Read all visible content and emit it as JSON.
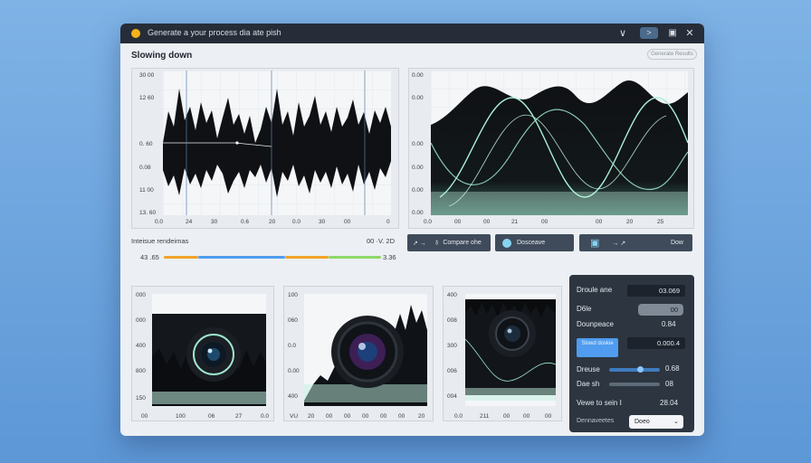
{
  "window": {
    "title": "Generate a your process dia ate pish",
    "minimize_glyph": "∨",
    "go_glyph": ">",
    "save_glyph": "▣",
    "close_glyph": "✕"
  },
  "heading": "Slowing down",
  "top_pill": "Generate Results",
  "colors": {
    "accent": "#4f9cf0",
    "titlebar": "#262d38",
    "side_panel": "#2d3540",
    "wave_fill": "#0f1114",
    "glow": "#9fe8cf",
    "meter_orange": "#f2a42a",
    "meter_blue": "#4f9cf0",
    "meter_green": "#8ed86a"
  },
  "chart1": {
    "y_ticks": [
      "30 00",
      "12 60",
      "0. 60",
      "0.08",
      "11 00",
      "13. 60"
    ],
    "x_ticks": [
      "0.0",
      "24",
      "30",
      "0.6",
      "20",
      "0.0",
      "30",
      "00",
      "0"
    ]
  },
  "chart2": {
    "y_ticks": [
      "0.00",
      "0.00",
      "0.00",
      "0.00",
      "0.00",
      "0.00"
    ],
    "x_ticks": [
      "0.0",
      "00",
      "00",
      "21",
      "00",
      "00",
      "20",
      "25"
    ]
  },
  "meter": {
    "title": "Inteisue rendeimas",
    "right_value": "00 ·V. 2D",
    "left_value": "43 .65",
    "end_value": "3.36"
  },
  "toolbar": {
    "share_label": "↗ →",
    "node_icon": "♁",
    "compare_label": "Compare ohe",
    "record_label": "Dosceave",
    "camera_icon": "▣",
    "arrows_label": "→ ↗",
    "dow_label": "Dow"
  },
  "chart3": {
    "y_ticks": [
      "000",
      "000",
      "400",
      "800",
      "150"
    ],
    "x_ticks": [
      "00",
      "100",
      "06",
      "27",
      "0.0"
    ]
  },
  "chart4": {
    "y_ticks": [
      "100",
      "060",
      "0.0",
      "0.00",
      "400"
    ],
    "x_ticks": [
      "VU",
      "20",
      "00",
      "00",
      "00",
      "00",
      "00",
      "20"
    ]
  },
  "chart5": {
    "y_ticks": [
      "400",
      "008",
      "300",
      "006",
      "004"
    ],
    "x_ticks": [
      "0.0",
      "211",
      "00",
      "00",
      "00"
    ]
  },
  "side_panel": {
    "row1_label": "Droule ane",
    "row1_value": "03.069",
    "row2_label": "D6le",
    "row2_value": "00",
    "row3_label": "Dounpeace",
    "row3_value": "0.84",
    "button_label": "Slowd doskie",
    "row4_value": "0.000.4",
    "slider1_label": "Dreuse",
    "slider1_value": "0.68",
    "slider1_level": 0.62,
    "slider2_label": "Dae sh",
    "slider2_value": "08",
    "slider2_level": 0.5,
    "total_label": "Vewe to sein I",
    "total_value": "28.04",
    "dropdown_label": "Dennaveetes",
    "dropdown_value": "Doeo"
  }
}
